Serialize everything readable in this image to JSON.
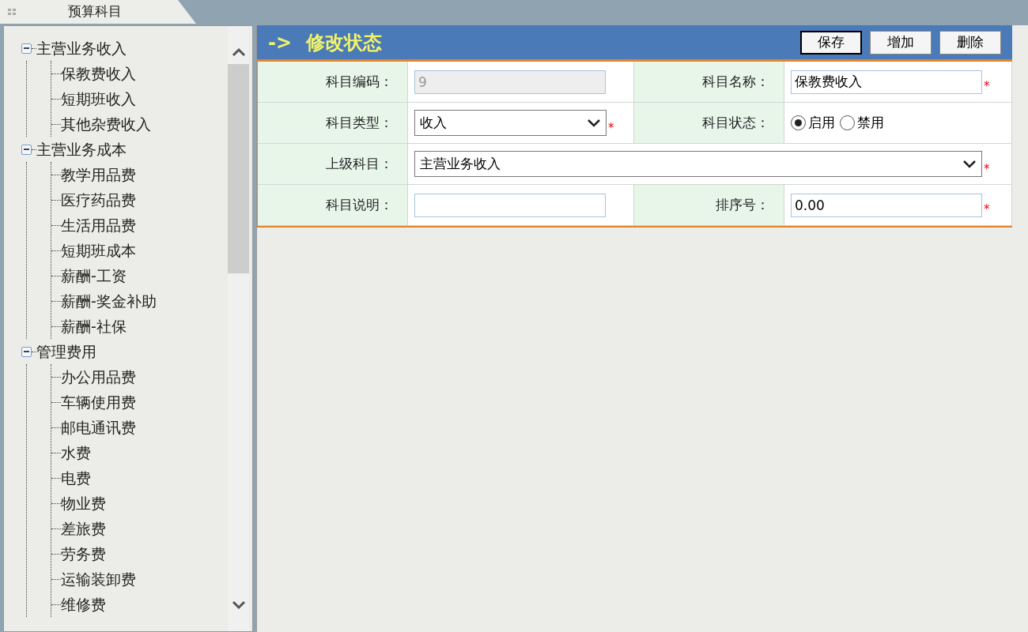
{
  "tab": {
    "title": "预算科目"
  },
  "tree": [
    {
      "label": "主营业务收入",
      "expanded": true,
      "children": [
        {
          "label": "保教费收入"
        },
        {
          "label": "短期班收入"
        },
        {
          "label": "其他杂费收入"
        }
      ]
    },
    {
      "label": "主营业务成本",
      "expanded": true,
      "children": [
        {
          "label": "教学用品费"
        },
        {
          "label": "医疗药品费"
        },
        {
          "label": "生活用品费"
        },
        {
          "label": "短期班成本"
        },
        {
          "label": "薪酬-工资"
        },
        {
          "label": "薪酬-奖金补助"
        },
        {
          "label": "薪酬-社保"
        }
      ]
    },
    {
      "label": "管理费用",
      "expanded": true,
      "children": [
        {
          "label": "办公用品费"
        },
        {
          "label": "车辆使用费"
        },
        {
          "label": "邮电通讯费"
        },
        {
          "label": "水费"
        },
        {
          "label": "电费"
        },
        {
          "label": "物业费"
        },
        {
          "label": "差旅费"
        },
        {
          "label": "劳务费"
        },
        {
          "label": "运输装卸费"
        },
        {
          "label": "维修费"
        }
      ]
    }
  ],
  "header": {
    "arrow": "->",
    "title": "修改状态",
    "buttons": [
      "保存",
      "增加",
      "删除"
    ]
  },
  "form": [
    [
      {
        "label": "科目编码：",
        "kind": "text",
        "value": "9",
        "disabled": true
      },
      {
        "label": "科目名称：",
        "kind": "text",
        "value": "保教费收入",
        "disabled": false,
        "required_mark": "*"
      }
    ],
    [
      {
        "label": "科目类型：",
        "kind": "select",
        "value": "收入",
        "required_mark": "*"
      },
      {
        "label": "科目状态：",
        "kind": "radio",
        "options": [
          {
            "label": "启用",
            "selected": true
          },
          {
            "label": "禁用",
            "selected": false
          }
        ]
      }
    ],
    [
      {
        "label": "上级科目：",
        "kind": "select",
        "value": "主营业务收入",
        "required_mark": "*",
        "wide": true
      }
    ],
    [
      {
        "label": "科目说明：",
        "kind": "text",
        "disabled": false
      },
      {
        "label": "排序号：",
        "kind": "text",
        "value": "0.00",
        "disabled": false,
        "required_mark": "*"
      }
    ]
  ]
}
